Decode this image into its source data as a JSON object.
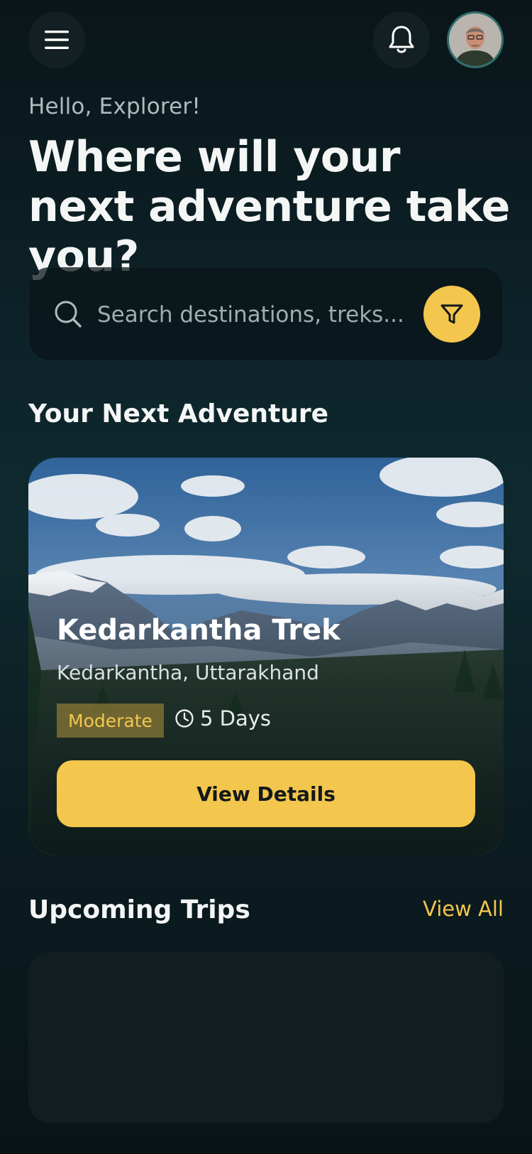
{
  "header": {
    "menu_icon": "hamburger-menu-icon",
    "bell_icon": "bell-icon",
    "avatar": "user-avatar"
  },
  "greeting": "Hello, Explorer!",
  "headline": "Where will your next adventure take you?",
  "search": {
    "placeholder": "Search destinations, treks...",
    "search_icon": "search-icon",
    "filter_icon": "filter-icon"
  },
  "next_adventure": {
    "section_title": "Your Next Adventure",
    "trek_name": "Kedarkantha Trek",
    "location": "Kedarkantha, Uttarakhand",
    "difficulty": "Moderate",
    "duration": "5 Days",
    "button_label": "View Details"
  },
  "upcoming": {
    "section_title": "Upcoming Trips",
    "view_all_label": "View All"
  },
  "colors": {
    "accent": "#f3c74d",
    "background": "#0c2228",
    "text_primary": "#f4f6f6",
    "text_secondary": "#aebbbf"
  }
}
